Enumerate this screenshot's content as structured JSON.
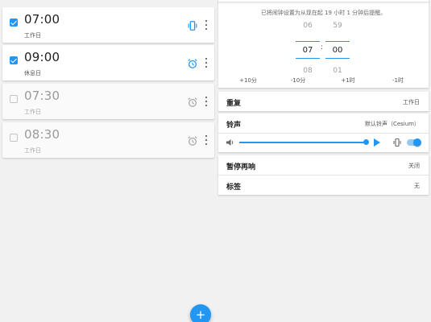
{
  "colors": {
    "accent": "#2196f3",
    "background": "#f1f1f1",
    "card": "#ffffff"
  },
  "alarms": [
    {
      "time": "07:00",
      "days": "工作日",
      "enabled": true,
      "icon": "vibrate-icon"
    },
    {
      "time": "09:00",
      "days": "休息日",
      "enabled": true,
      "icon": "alarm-clock-icon"
    },
    {
      "time": "07:30",
      "days": "工作日",
      "enabled": false,
      "icon": "alarm-clock-icon"
    },
    {
      "time": "08:30",
      "days": "工作日",
      "enabled": false,
      "icon": "alarm-clock-icon"
    }
  ],
  "fab": {
    "label": "+"
  },
  "editor": {
    "hint": "已将闹钟设置为从现在起 19 小时 1 分钟后提醒。",
    "picker": {
      "hours": {
        "prev": "06",
        "selected": "07",
        "next": "08"
      },
      "minutes": {
        "prev": "59",
        "selected": "00",
        "next": "01"
      },
      "separator": ":"
    },
    "quick_adjust": [
      "+10分",
      "-10分",
      "+1时",
      "-1时"
    ],
    "repeat": {
      "label": "重复",
      "value": "工作日"
    },
    "ringtone": {
      "label": "铃声",
      "value": "默认铃声（Cesium）",
      "volume_fraction": 0.96,
      "vibrate_on": true
    },
    "snooze": {
      "label": "暂停再响",
      "value": "关闭"
    },
    "tag": {
      "label": "标签",
      "value": "无"
    }
  }
}
